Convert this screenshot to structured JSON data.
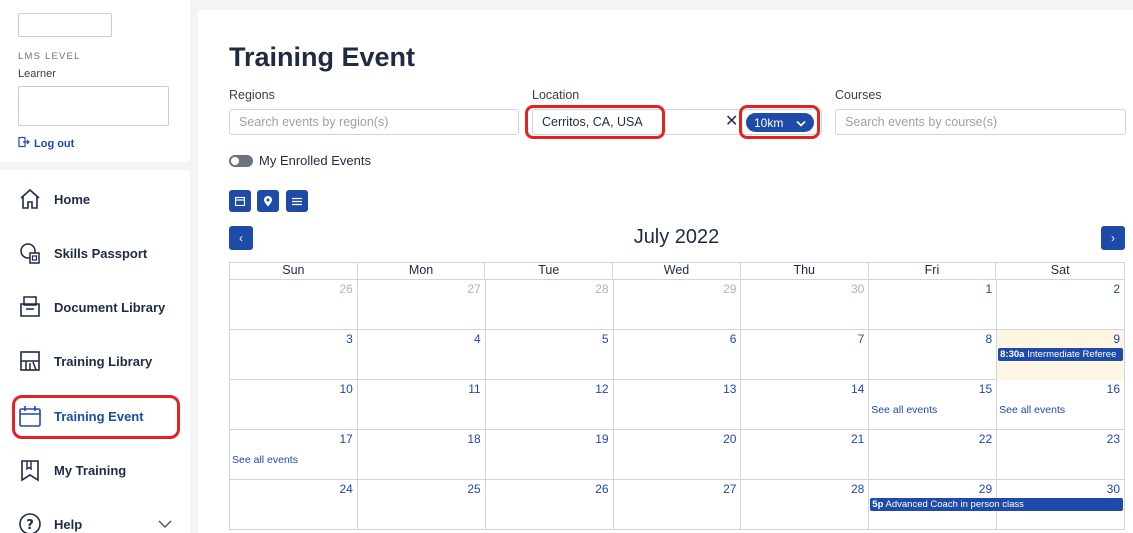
{
  "sidebar": {
    "lms_level_label": "LMS LEVEL",
    "lms_level_value": "Learner",
    "logout_label": "Log out",
    "nav": [
      {
        "label": "Home",
        "icon": "home-icon"
      },
      {
        "label": "Skills Passport",
        "icon": "passport-icon"
      },
      {
        "label": "Document Library",
        "icon": "folder-icon"
      },
      {
        "label": "Training Library",
        "icon": "library-icon"
      },
      {
        "label": "Training Event",
        "icon": "calendar-icon"
      },
      {
        "label": "My Training",
        "icon": "bookmark-icon"
      },
      {
        "label": "Help",
        "icon": "help-icon"
      }
    ]
  },
  "page": {
    "title": "Training Event"
  },
  "filters": {
    "regions_label": "Regions",
    "regions_placeholder": "Search events by region(s)",
    "location_label": "Location",
    "location_value": "Cerritos, CA, USA",
    "distance_value": "10km",
    "courses_label": "Courses",
    "courses_placeholder": "Search events by course(s)"
  },
  "toggle": {
    "label": "My Enrolled Events"
  },
  "calendar": {
    "month_title": "July 2022",
    "weekdays": [
      "Sun",
      "Mon",
      "Tue",
      "Wed",
      "Thu",
      "Fri",
      "Sat"
    ],
    "weeks": [
      [
        {
          "d": "26",
          "other": true
        },
        {
          "d": "27",
          "other": true
        },
        {
          "d": "28",
          "other": true
        },
        {
          "d": "29",
          "other": true
        },
        {
          "d": "30",
          "other": true
        },
        {
          "d": "1"
        },
        {
          "d": "2"
        }
      ],
      [
        {
          "d": "3"
        },
        {
          "d": "4"
        },
        {
          "d": "5"
        },
        {
          "d": "6"
        },
        {
          "d": "7"
        },
        {
          "d": "8"
        },
        {
          "d": "9",
          "today": true,
          "event_time": "8:30a",
          "event_title": "Intermediate Referee"
        }
      ],
      [
        {
          "d": "10"
        },
        {
          "d": "11"
        },
        {
          "d": "12"
        },
        {
          "d": "13"
        },
        {
          "d": "14"
        },
        {
          "d": "15",
          "see_all": "See all events"
        },
        {
          "d": "16",
          "see_all": "See all events"
        }
      ],
      [
        {
          "d": "17",
          "see_all": "See all events"
        },
        {
          "d": "18"
        },
        {
          "d": "19"
        },
        {
          "d": "20"
        },
        {
          "d": "21"
        },
        {
          "d": "22"
        },
        {
          "d": "23"
        }
      ],
      [
        {
          "d": "24"
        },
        {
          "d": "25"
        },
        {
          "d": "26"
        },
        {
          "d": "27"
        },
        {
          "d": "28"
        },
        {
          "d": "29",
          "event_time": "5p",
          "event_title": "Advanced Coach in person class",
          "span": 2
        },
        {
          "d": "30"
        }
      ]
    ]
  },
  "colors": {
    "accent": "#1e4aa8",
    "highlight": "#e32222",
    "today_bg": "#fcf6e3"
  }
}
